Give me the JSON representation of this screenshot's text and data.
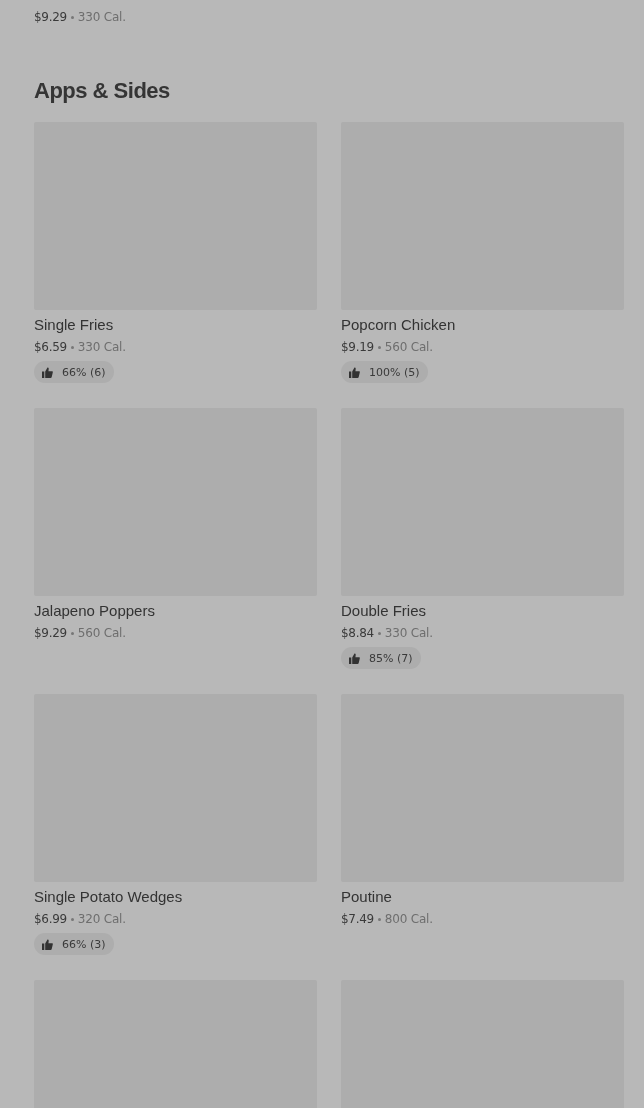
{
  "previous_item": {
    "price": "$9.29",
    "calories": "330 Cal."
  },
  "section": {
    "title": "Apps & Sides",
    "items": [
      {
        "kind": "item",
        "name": "Single Fries",
        "price": "$6.59",
        "calories": "330 Cal.",
        "rating": "66% (6)"
      },
      {
        "kind": "item",
        "name": "Popcorn Chicken",
        "price": "$9.19",
        "calories": "560 Cal.",
        "rating": "100% (5)"
      },
      {
        "kind": "item",
        "name": "Jalapeno Poppers",
        "price": "$9.29",
        "calories": "560 Cal."
      },
      {
        "kind": "item",
        "name": "Double Fries",
        "price": "$8.84",
        "calories": "330 Cal.",
        "rating": "85% (7)"
      },
      {
        "kind": "item",
        "name": "Single Potato Wedges",
        "price": "$6.99",
        "calories": "320 Cal.",
        "rating": "66% (3)"
      },
      {
        "kind": "item",
        "name": "Poutine",
        "price": "$7.49",
        "calories": "800 Cal."
      },
      {
        "kind": "image_only"
      },
      {
        "kind": "image_only"
      }
    ]
  }
}
